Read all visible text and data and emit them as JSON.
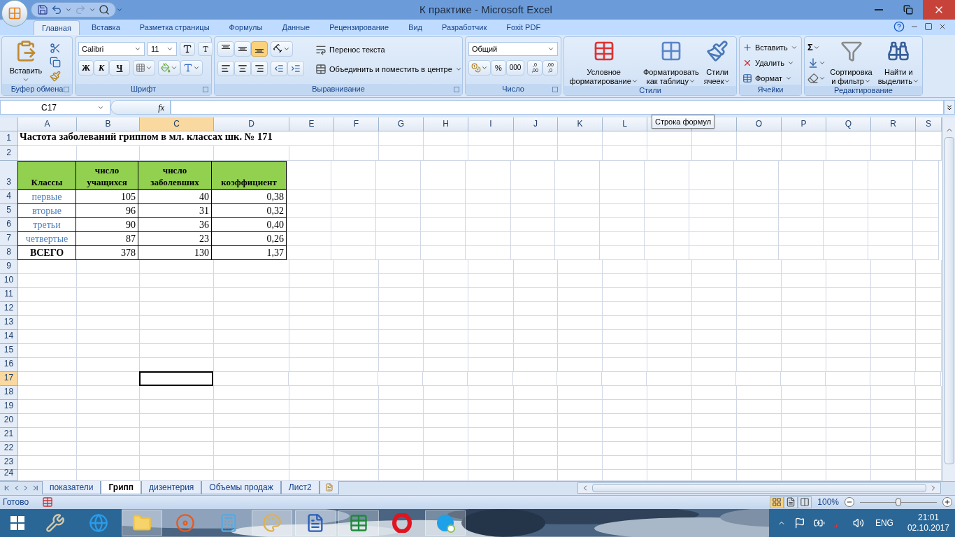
{
  "window": {
    "title": "К практике - Microsoft Excel"
  },
  "ribbon": {
    "tabs": [
      {
        "label": "Главная",
        "selected": true
      },
      {
        "label": "Вставка",
        "selected": false
      },
      {
        "label": "Разметка страницы",
        "selected": false
      },
      {
        "label": "Формулы",
        "selected": false
      },
      {
        "label": "Данные",
        "selected": false
      },
      {
        "label": "Рецензирование",
        "selected": false
      },
      {
        "label": "Вид",
        "selected": false
      },
      {
        "label": "Разработчик",
        "selected": false
      },
      {
        "label": "Foxit PDF",
        "selected": false
      }
    ],
    "clipboard": {
      "label": "Буфер обмена",
      "paste": "Вставить"
    },
    "font": {
      "label": "Шрифт",
      "family": "Calibri",
      "size": "11",
      "bold": "Ж",
      "italic": "К",
      "underline": "Ч"
    },
    "alignment": {
      "label": "Выравнивание",
      "vertical": [
        {
          "selected": false
        },
        {
          "selected": false
        },
        {
          "selected": true
        }
      ],
      "wrap": "Перенос текста",
      "merge": "Объединить и поместить в центре"
    },
    "number": {
      "label": "Число",
      "format": "Общий",
      "percent": "%",
      "thousands": "000",
      "decimals": [
        {
          "top": ",0",
          "bottom": ",00"
        },
        {
          "top": ",00",
          "bottom": ",0"
        }
      ]
    },
    "styles": {
      "label": "Стили",
      "buttons": [
        {
          "kind": "conditional",
          "lines": [
            "Условное",
            "форматирование"
          ]
        },
        {
          "kind": "table",
          "lines": [
            "Форматировать",
            "как таблицу"
          ]
        },
        {
          "kind": "cell",
          "lines": [
            "Стили",
            "ячеек"
          ]
        }
      ]
    },
    "cells": {
      "label": "Ячейки",
      "buttons": [
        {
          "kind": "insert",
          "label": "Вставить"
        },
        {
          "kind": "delete",
          "label": "Удалить"
        },
        {
          "kind": "format",
          "label": "Формат"
        }
      ]
    },
    "editing": {
      "label": "Редактирование",
      "sum": "Σ",
      "sort": [
        "Сортировка",
        "и фильтр"
      ],
      "find": [
        "Найти и",
        "выделить"
      ]
    }
  },
  "formula_bar": {
    "name_box": "C17",
    "fx": "fx",
    "tooltip": "Строка формул"
  },
  "sheet": {
    "columns": [
      {
        "label": "A",
        "selected": false
      },
      {
        "label": "B",
        "selected": false
      },
      {
        "label": "C",
        "selected": true
      },
      {
        "label": "D",
        "selected": false
      },
      {
        "label": "E",
        "selected": false
      },
      {
        "label": "F",
        "selected": false
      },
      {
        "label": "G",
        "selected": false
      },
      {
        "label": "H",
        "selected": false
      },
      {
        "label": "I",
        "selected": false
      },
      {
        "label": "J",
        "selected": false
      },
      {
        "label": "K",
        "selected": false
      },
      {
        "label": "L",
        "selected": false
      },
      {
        "selected": false
      },
      {
        "selected": false
      },
      {
        "label": "O",
        "selected": false
      },
      {
        "label": "P",
        "selected": false
      },
      {
        "label": "Q",
        "selected": false
      },
      {
        "label": "R",
        "selected": false
      },
      {
        "label": "S",
        "selected": false
      }
    ],
    "rows": [
      {
        "label": "1",
        "selected": false
      },
      {
        "label": "2",
        "selected": false
      },
      {
        "label": "3",
        "selected": false
      },
      {
        "label": "4",
        "selected": false
      },
      {
        "label": "5",
        "selected": false
      },
      {
        "label": "6",
        "selected": false
      },
      {
        "label": "7",
        "selected": false
      },
      {
        "label": "8",
        "selected": false
      },
      {
        "label": "9",
        "selected": false
      },
      {
        "label": "10",
        "selected": false
      },
      {
        "label": "11",
        "selected": false
      },
      {
        "label": "12",
        "selected": false
      },
      {
        "label": "13",
        "selected": false
      },
      {
        "label": "14",
        "selected": false
      },
      {
        "label": "15",
        "selected": false
      },
      {
        "label": "16",
        "selected": false
      },
      {
        "label": "17",
        "selected": true
      },
      {
        "label": "18",
        "selected": false
      },
      {
        "label": "19",
        "selected": false
      },
      {
        "label": "20",
        "selected": false
      },
      {
        "label": "21",
        "selected": false
      },
      {
        "label": "22",
        "selected": false
      },
      {
        "label": "23",
        "selected": false
      },
      {
        "label": "24",
        "selected": false
      }
    ],
    "title": "Частота заболеваний гриппом в мл. классах шк. № 171",
    "table": {
      "columns": [
        "Классы",
        "число учащихся",
        "число заболевших",
        "коэффициент"
      ],
      "rows": [
        {
          "kind": "body",
          "cells": [
            "первые",
            "105",
            "40",
            "0,38"
          ]
        },
        {
          "kind": "body",
          "cells": [
            "вторые",
            "96",
            "31",
            "0,32"
          ]
        },
        {
          "kind": "body",
          "cells": [
            "третьи",
            "90",
            "36",
            "0,40"
          ]
        },
        {
          "kind": "body",
          "cells": [
            "четвертые",
            "87",
            "23",
            "0,26"
          ]
        },
        {
          "kind": "total",
          "cells": [
            "ВСЕГО",
            "378",
            "130",
            "1,37"
          ]
        }
      ]
    }
  },
  "sheet_tabs": [
    {
      "label": "показатели",
      "selected": false
    },
    {
      "label": "Грипп",
      "selected": true
    },
    {
      "label": "дизентерия",
      "selected": false
    },
    {
      "label": "Объемы продаж",
      "selected": false
    },
    {
      "label": "Лист2",
      "selected": false
    }
  ],
  "status_bar": {
    "status": "Готово",
    "views": [
      {
        "kind": "normal",
        "selected": true
      },
      {
        "kind": "layout",
        "selected": false
      },
      {
        "kind": "pagebreak",
        "selected": false
      }
    ],
    "zoom": "100%",
    "zoom_level": {
      "level": 0.5
    }
  },
  "taskbar": {
    "apps": [
      {
        "kind": "tools",
        "selected": false
      },
      {
        "kind": "browser",
        "selected": false
      },
      {
        "kind": "folder",
        "selected": true
      },
      {
        "kind": "disc",
        "selected": false
      },
      {
        "kind": "calculator",
        "selected": false
      },
      {
        "kind": "paint",
        "selected": true
      },
      {
        "kind": "word",
        "selected": true
      },
      {
        "kind": "excel",
        "selected": true
      },
      {
        "kind": "opera",
        "selected": false
      },
      {
        "kind": "skype",
        "selected": true
      }
    ],
    "language": "ENG",
    "time": "21:01",
    "date": "02.10.2017"
  }
}
